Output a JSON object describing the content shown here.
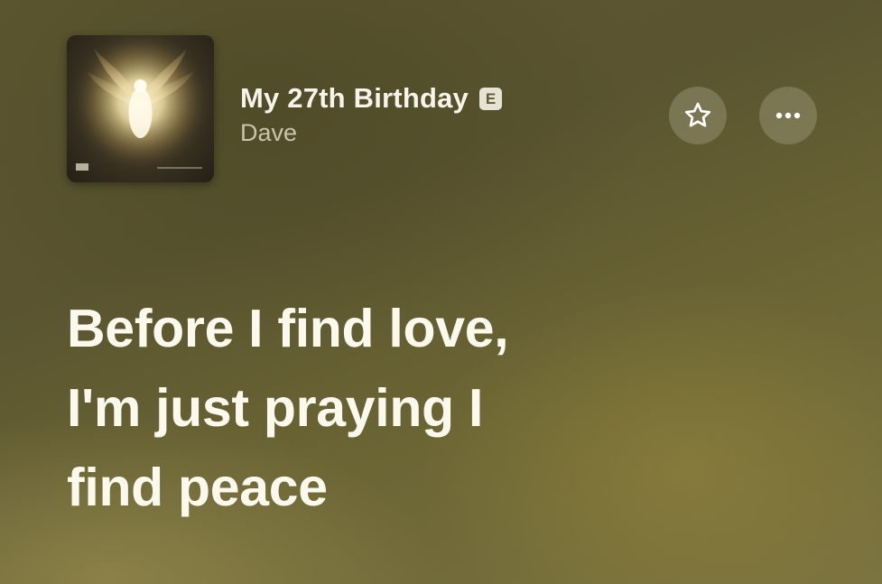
{
  "now_playing": {
    "song_title": "My 27th Birthday",
    "explicit_badge": "E",
    "artist": "Dave",
    "artwork_icon": "album-artwork-angel"
  },
  "actions": {
    "favorite_icon": "star-icon",
    "more_icon": "ellipsis-icon"
  },
  "lyrics": {
    "lines": [
      "Before I find love,",
      "I'm just praying I",
      "find peace"
    ]
  },
  "colors": {
    "background": "#625c32",
    "lyric_text": "#fbf9ee",
    "artist_text": "#c9c4ab"
  }
}
